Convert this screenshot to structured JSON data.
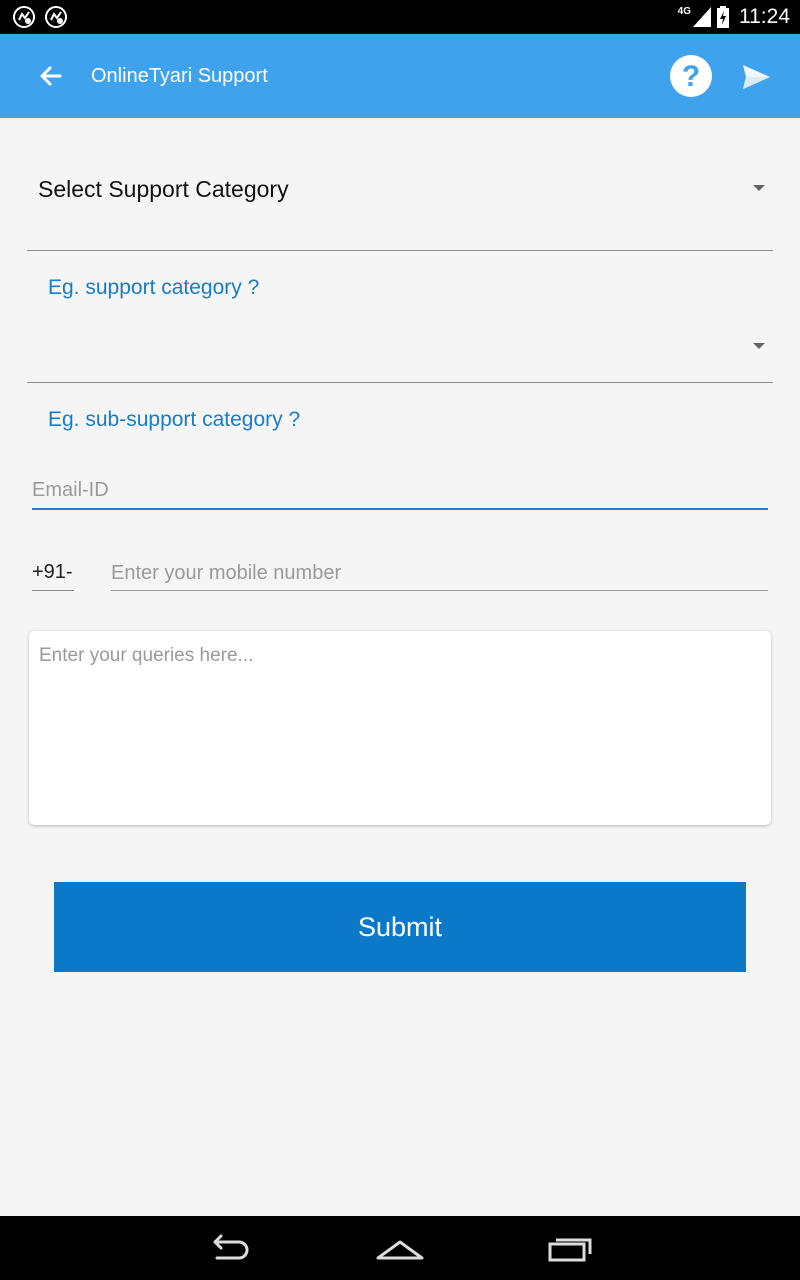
{
  "status_bar": {
    "network": "4G",
    "time": "11:24",
    "left_icons": [
      "notification-icon",
      "notification-icon"
    ]
  },
  "app_bar": {
    "title": "OnlineTyari Support",
    "help_label": "?",
    "color": "#3ea3ec"
  },
  "form": {
    "category_spinner": "Select Support Category",
    "category_hint": "Eg. support category ?",
    "subcategory_spinner": "",
    "subcategory_hint": "Eg. sub-support category ?",
    "email_placeholder": "Email-ID",
    "email_value": "",
    "phone_prefix": "+91-",
    "mobile_placeholder": "Enter your mobile number",
    "mobile_value": "",
    "query_placeholder": "Enter your queries here...",
    "submit_label": "Submit"
  },
  "colors": {
    "accent": "#0b79c8",
    "hint_text": "#1a7cc7",
    "background": "#f5f5f5"
  },
  "nav_bar": {
    "icons": [
      "back-icon",
      "home-icon",
      "recents-icon"
    ]
  }
}
